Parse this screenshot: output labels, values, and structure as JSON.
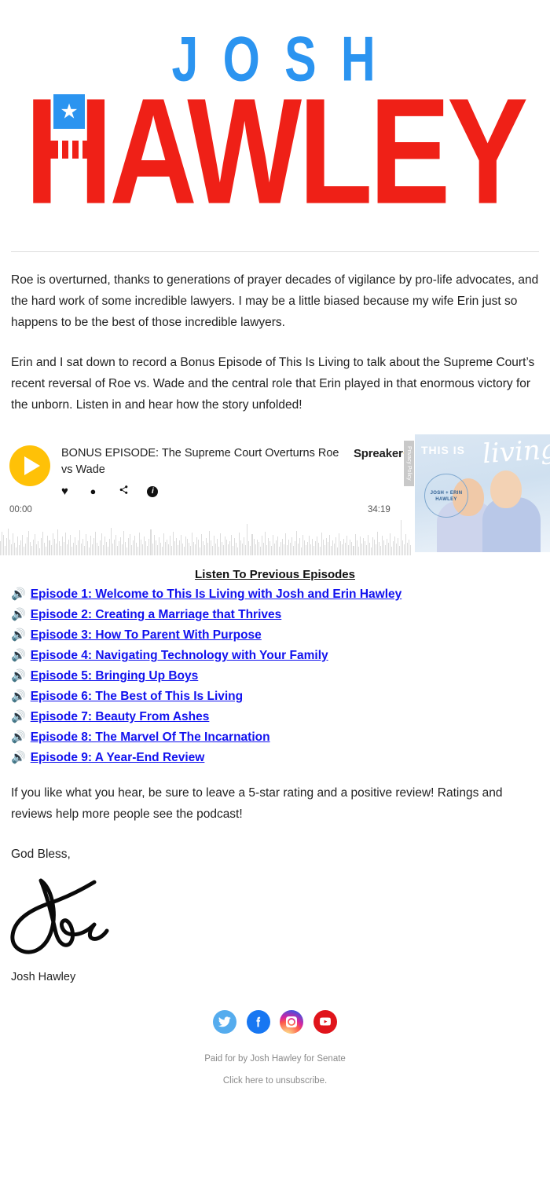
{
  "logo": {
    "first_name": "JOSH",
    "last_name": "HAWLEY",
    "blue": "#2b94f0",
    "red": "#ef2017",
    "star_glyph": "★"
  },
  "body": {
    "paragraph_1": "Roe is overturned, thanks to generations of prayer decades of vigilance by pro-life advocates, and the hard work of some incredible lawyers. I may be a little biased because my wife Erin just so happens to be the best of those incredible lawyers.",
    "paragraph_2": "Erin and I sat down to record a Bonus Episode of This Is Living to talk about the Supreme Court’s recent reversal of Roe vs. Wade and the central role that Erin played in that enormous victory for the unborn. Listen in and hear how the story unfolded!"
  },
  "player": {
    "episode_title": "BONUS EPISODE: The Supreme Court Overturns Roe vs Wade",
    "brand": "Spreaker",
    "brand_star": "✦",
    "privacy_tab": "Privacy Policy",
    "time_current": "00:00",
    "time_total": "34:19",
    "play_icon": "play-icon",
    "actions": [
      {
        "name": "like-icon",
        "glyph": "♥"
      },
      {
        "name": "comment-icon",
        "glyph": "💬"
      },
      {
        "name": "share-icon",
        "glyph": "share"
      },
      {
        "name": "info-icon",
        "glyph": "i"
      }
    ],
    "accent": "#ffc107",
    "waveform_color": "#dcdcdc",
    "cover": {
      "line1": "THIS IS",
      "line2": "living",
      "badge_line1": "JOSH + ERIN",
      "badge_line2": "HAWLEY"
    }
  },
  "episodes": {
    "heading": "Listen To Previous Episodes",
    "icon": "speaker-icon",
    "icon_glyph": "🔊",
    "link_color": "#1111ee",
    "items": [
      "Episode 1: Welcome to This Is Living with Josh and Erin Hawley",
      "Episode 2: Creating a Marriage that Thrives",
      "Episode 3: How To Parent With Purpose",
      "Episode 4: Navigating Technology with Your Family",
      "Episode 5: Bringing Up Boys",
      "Episode 6: The Best of This Is Living",
      "Episode 7: Beauty From Ashes",
      "Episode 8: The Marvel Of The Incarnation",
      "Episode 9: A Year-End Review"
    ]
  },
  "closing": {
    "review_text": "If you like what you hear, be sure to leave a 5-star rating and a positive review! Ratings and reviews help more people see the podcast!",
    "salutation": "God Bless,",
    "signature_name": "Josh Hawley"
  },
  "social": [
    {
      "name": "twitter-icon",
      "label": "Twitter",
      "color": "#55acee"
    },
    {
      "name": "facebook-icon",
      "label": "Facebook",
      "color": "#1877f2"
    },
    {
      "name": "instagram-icon",
      "label": "Instagram",
      "color": "#d6249f"
    },
    {
      "name": "youtube-icon",
      "label": "YouTube",
      "color": "#e0141b"
    }
  ],
  "footer": {
    "disclaimer": "Paid for by Josh Hawley for Senate",
    "unsubscribe": "Click here to unsubscribe."
  }
}
